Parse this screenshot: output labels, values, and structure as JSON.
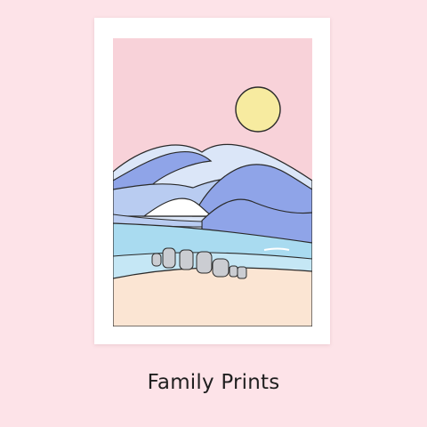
{
  "product": {
    "title": "Family Prints"
  },
  "artwork": {
    "subject": "beach-waves-print",
    "colors": {
      "page_background": "#fde3e8",
      "card": "#ffffff",
      "sky": "#f8d2d9",
      "sun": "#f7eba0",
      "wave_dark": "#8fa4e8",
      "wave_mid": "#b9ccf1",
      "wave_light": "#dbe6f8",
      "sea": "#a9dbf0",
      "sand": "#fbe5d3",
      "rocks": "#cbcdd2"
    }
  }
}
